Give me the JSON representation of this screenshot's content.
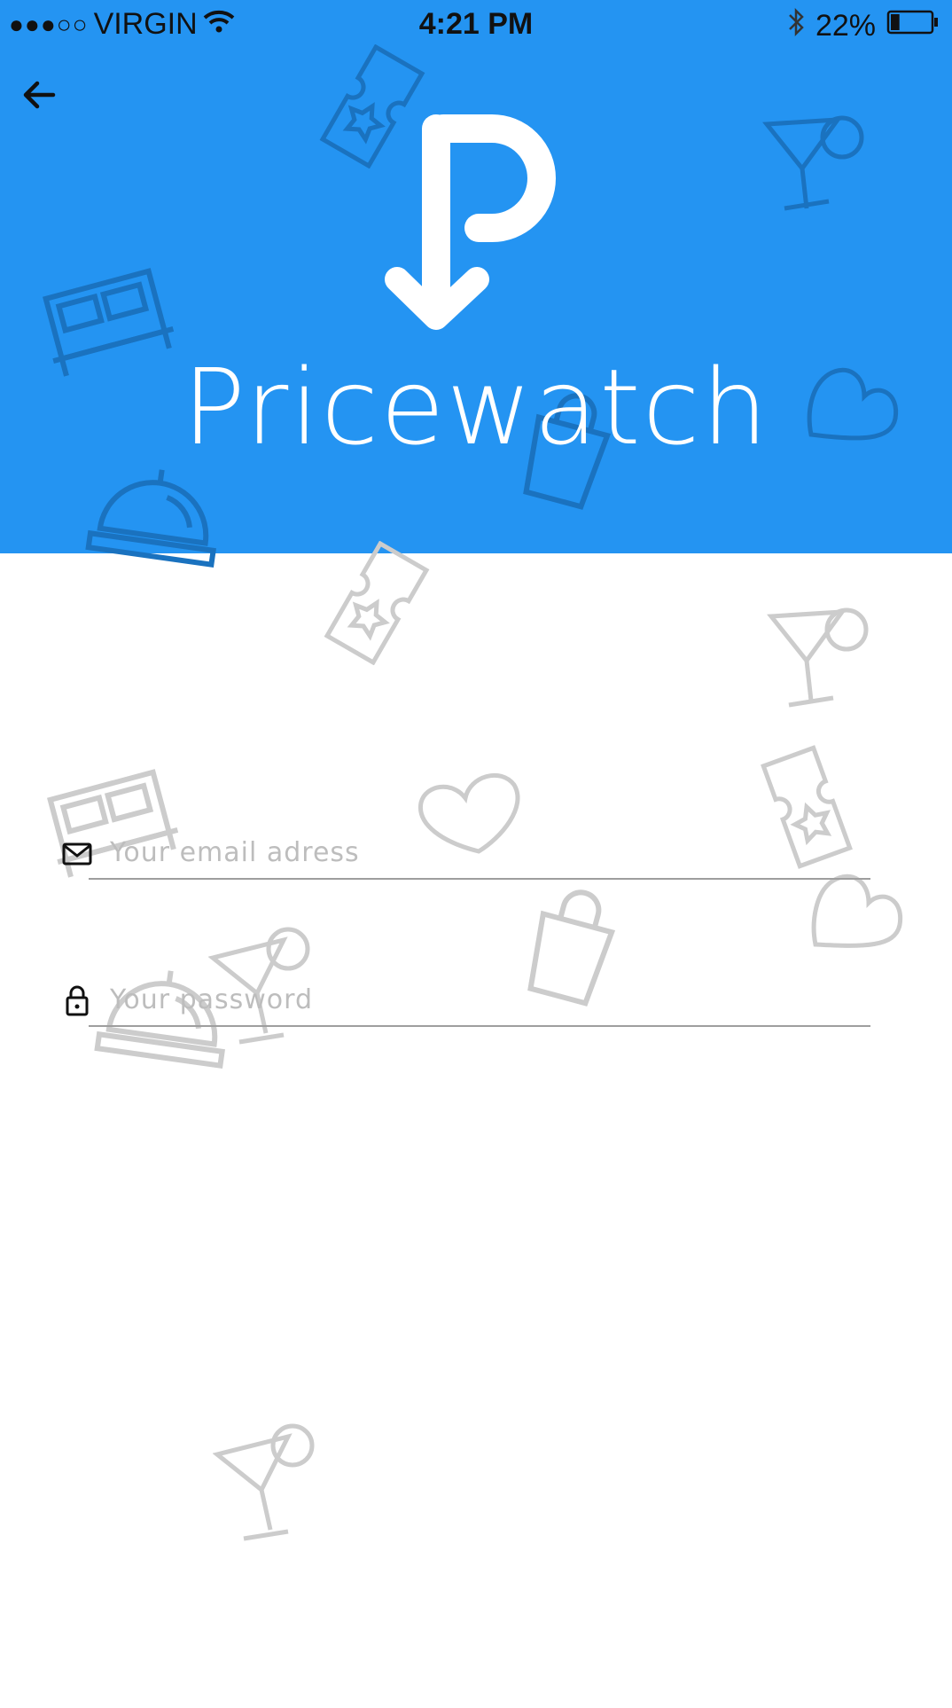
{
  "status_bar": {
    "signal": "●●●○○",
    "carrier": "VIRGIN",
    "time": "4:21 PM",
    "battery": "22%",
    "battery_level": 0.22
  },
  "header": {
    "app_name": "Pricewatch",
    "color": "#2494f2"
  },
  "form": {
    "email_placeholder": "Your email adress",
    "email_value": "",
    "password_placeholder": "Your password",
    "password_value": ""
  },
  "icons": {
    "back": "arrow-left-icon",
    "email": "envelope-icon",
    "password": "lock-icon",
    "logo": "pricewatch-logo-icon"
  }
}
